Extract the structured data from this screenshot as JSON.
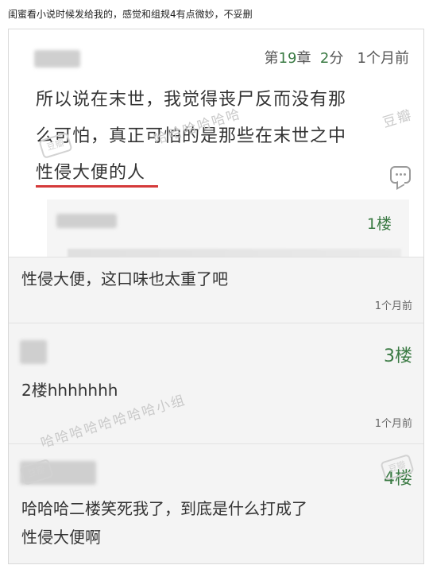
{
  "caption": "闺蜜看小说时候发给我的，感觉和组规4有点微妙，不妥删",
  "main_comment": {
    "chapter": "第19章",
    "chapter_prefix": "第",
    "chapter_num": "19",
    "chapter_suffix": "章",
    "score_num": "2",
    "score_suffix": "分",
    "time": "1个月前",
    "line1": "所以说在末世，我觉得丧尸反而没有那",
    "line2": "么可怕，真正可怕的是那些在末世之中",
    "line3": "性侵大便的人",
    "floor": "1楼"
  },
  "replies": [
    {
      "text": "性侵大便，这口味也太重了吧",
      "time": "1个月前"
    },
    {
      "floor": "3楼",
      "text": "2楼hhhhhhh",
      "time": "1个月前"
    },
    {
      "floor": "4楼",
      "text_line1": "哈哈哈二楼笑死我了，到底是什么打成了",
      "text_line2": "性侵大便啊"
    }
  ],
  "watermark": {
    "text1": "哈哈哈哈哈哈",
    "text2": "哈哈哈哈哈哈哈哈小组",
    "badge": "豆瓣"
  }
}
